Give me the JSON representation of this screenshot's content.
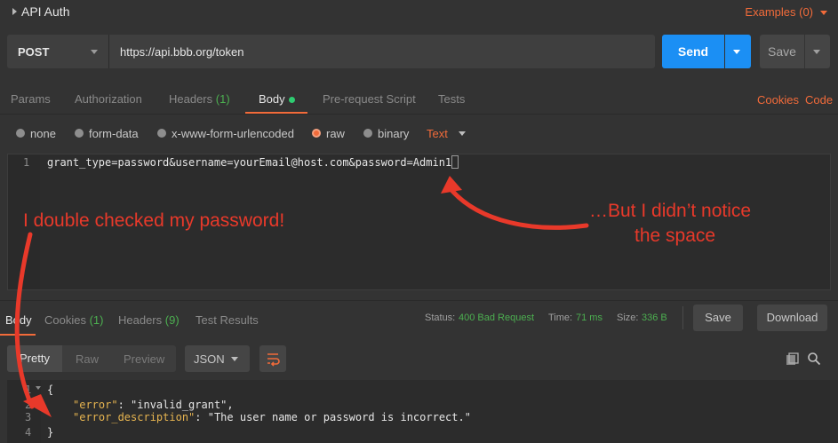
{
  "header": {
    "title": "API Auth",
    "examples_label": "Examples (0)"
  },
  "request": {
    "method": "POST",
    "url": "https://api.bbb.org/token",
    "send_label": "Send",
    "save_label": "Save"
  },
  "request_tabs": {
    "params": "Params",
    "authorization": "Authorization",
    "headers": "Headers",
    "headers_count": "(1)",
    "body": "Body",
    "pre_request": "Pre-request Script",
    "tests": "Tests",
    "cookies": "Cookies",
    "code": "Code"
  },
  "body_types": {
    "none": "none",
    "form_data": "form-data",
    "urlencoded": "x-www-form-urlencoded",
    "raw": "raw",
    "binary": "binary",
    "text_type": "Text"
  },
  "editor": {
    "line_number": "1",
    "content": "grant_type=password&username=yourEmail@host.com&password=Admin1"
  },
  "response_tabs": {
    "body": "Body",
    "cookies": "Cookies",
    "cookies_count": "(1)",
    "headers": "Headers",
    "headers_count": "(9)",
    "test_results": "Test Results"
  },
  "status": {
    "status_label": "Status:",
    "status_value": "400 Bad Request",
    "time_label": "Time:",
    "time_value": "71 ms",
    "size_label": "Size:",
    "size_value": "336 B"
  },
  "response_actions": {
    "save": "Save",
    "download": "Download"
  },
  "view": {
    "pretty": "Pretty",
    "raw": "Raw",
    "preview": "Preview",
    "format": "JSON"
  },
  "response_code": {
    "line_numbers": [
      "1",
      "2",
      "3",
      "4"
    ],
    "open_brace": "{",
    "close_brace": "}",
    "error_key": "\"error\"",
    "error_value": "\"invalid_grant\",",
    "desc_key": "\"error_description\"",
    "desc_value": "\"The user name or password is incorrect.\""
  },
  "annotations": {
    "left": "I double checked my password!",
    "right_line1": "…But I didn’t notice",
    "right_line2": "the space"
  },
  "colors": {
    "accent": "#f26b3a",
    "primary_button": "#1b8ff4",
    "success": "#4caf50",
    "annotation": "#e8392a"
  }
}
